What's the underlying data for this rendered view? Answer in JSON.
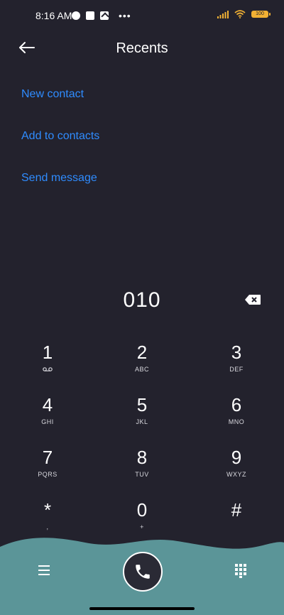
{
  "status_bar": {
    "time": "8:16 AM",
    "left_icons": [
      "app-icon",
      "square-icon",
      "upload-icon"
    ],
    "more": "•••",
    "battery_label": "100",
    "battery_color": "#f2b134"
  },
  "header": {
    "title": "Recents",
    "back_icon": "arrow-left-icon"
  },
  "actions": [
    {
      "label": "New contact"
    },
    {
      "label": "Add to contacts"
    },
    {
      "label": "Send message"
    }
  ],
  "dialer": {
    "number": "010",
    "backspace_icon": "backspace-icon"
  },
  "keypad": {
    "keys": [
      {
        "digit": "1",
        "letters": "",
        "icon": "voicemail-icon"
      },
      {
        "digit": "2",
        "letters": "ABC"
      },
      {
        "digit": "3",
        "letters": "DEF"
      },
      {
        "digit": "4",
        "letters": "GHI"
      },
      {
        "digit": "5",
        "letters": "JKL"
      },
      {
        "digit": "6",
        "letters": "MNO"
      },
      {
        "digit": "7",
        "letters": "PQRS"
      },
      {
        "digit": "8",
        "letters": "TUV"
      },
      {
        "digit": "9",
        "letters": "WXYZ"
      },
      {
        "digit": "*",
        "letters": ","
      },
      {
        "digit": "0",
        "letters": "+"
      },
      {
        "digit": "#",
        "letters": ""
      }
    ]
  },
  "bottom_bar": {
    "menu_icon": "menu-icon",
    "call_icon": "phone-icon",
    "keypad_icon": "dialpad-icon",
    "background": "#5b9598"
  },
  "theme": {
    "background": "#23222d",
    "accent": "#2f8cff"
  }
}
